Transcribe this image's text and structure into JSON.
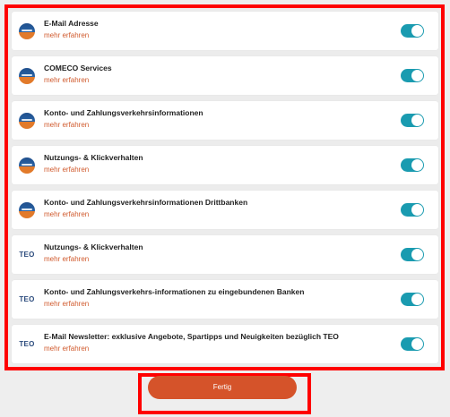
{
  "consents": [
    {
      "title": "E-Mail Adresse",
      "link": "mehr erfahren",
      "logo": "bank",
      "enabled": true
    },
    {
      "title": "COMECO Services",
      "link": "mehr erfahren",
      "logo": "bank",
      "enabled": true
    },
    {
      "title": "Konto- und Zahlungsverkehrsinformationen",
      "link": "mehr erfahren",
      "logo": "bank",
      "enabled": true
    },
    {
      "title": "Nutzungs- & Klickverhalten",
      "link": "mehr erfahren",
      "logo": "bank",
      "enabled": true
    },
    {
      "title": "Konto- und Zahlungsverkehrsinformationen Drittbanken",
      "link": "mehr erfahren",
      "logo": "bank",
      "enabled": true
    },
    {
      "title": "Nutzungs- & Klickverhalten",
      "link": "mehr erfahren",
      "logo": "teo",
      "logo_text": "TEO",
      "enabled": true
    },
    {
      "title": "Konto- und Zahlungsverkehrs-informationen zu eingebundenen Banken",
      "link": "mehr erfahren",
      "logo": "teo",
      "logo_text": "TEO",
      "enabled": true
    },
    {
      "title": "E-Mail Newsletter: exklusive Angebote, Spartipps und Neuigkeiten bezüglich TEO",
      "link": "mehr erfahren",
      "logo": "teo",
      "logo_text": "TEO",
      "enabled": true
    }
  ],
  "done_button": {
    "label": "Fertig"
  },
  "colors": {
    "accent": "#d5532a",
    "toggle_on": "#1a9bb0",
    "highlight": "#ff0000"
  }
}
